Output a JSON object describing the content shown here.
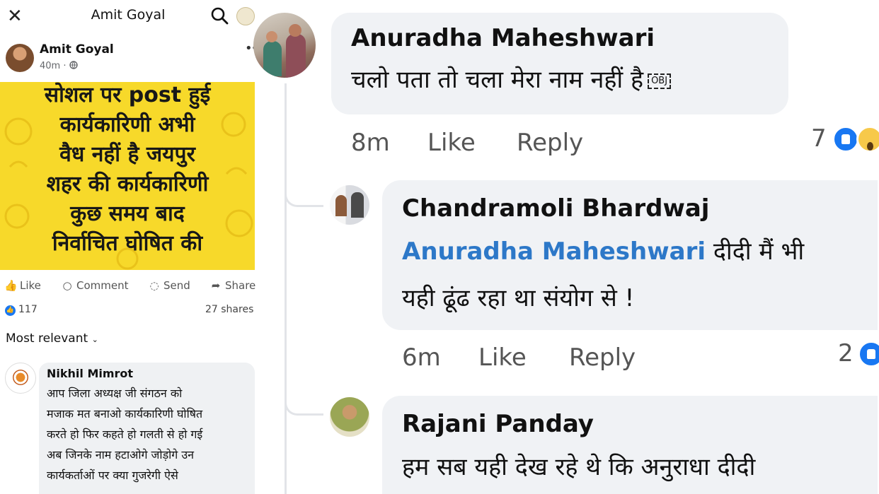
{
  "left_panel": {
    "topbar": {
      "close_glyph": "✕",
      "title": "Amit Goyal"
    },
    "post": {
      "author": "Amit Goyal",
      "time": "40m",
      "separator": "·",
      "image_text": [
        "सोशल पर post हुई",
        "कार्यकारिणी अभी",
        "वैध नहीं है जयपुर",
        "शहर की कार्यकारिणी",
        "कुछ समय बाद",
        "निर्वाचित घोषित की"
      ],
      "image_background": "#f7d92a",
      "actions": {
        "like": "Like",
        "comment": "Comment",
        "send": "Send",
        "share": "Share"
      },
      "likes_count": "117",
      "shares": "27 shares"
    },
    "sort_label": "Most relevant",
    "comment": {
      "author": "Nikhil Mimrot",
      "lines": [
        "आप जिला अध्यक्ष जी संगठन को",
        "मजाक मत बनाओ कार्यकारिणी घोषित",
        "करते हो फिर कहते हो गलती से हो गई",
        "अब जिनके नाम हटाओगे जोड़ोगे उन",
        "कार्यकर्ताओं पर क्या गुजरेगी ऐसे"
      ]
    }
  },
  "right_panel": {
    "comments": [
      {
        "author": "Anuradha Maheshwari",
        "text": "चलो पता तो चला मेरा नाम नहीं है",
        "obj_label": "OBJ",
        "time": "8m",
        "like": "Like",
        "reply": "Reply",
        "reactions": "7"
      },
      {
        "author": "Chandramoli Bhardwaj",
        "mention": "Anuradha Maheshwari",
        "text_after_mention": "दीदी मैं भी",
        "text_line2": "यही ढूंढ रहा था संयोग से  !",
        "time": "6m",
        "like": "Like",
        "reply": "Reply",
        "reactions": "2"
      },
      {
        "author": "Rajani Panday",
        "text": "हम सब यही देख रहे थे कि अनुराधा दीदी"
      }
    ]
  },
  "colors": {
    "link_blue": "#2d78c8",
    "like_blue": "#1877f2",
    "bubble_gray": "#f0f2f5"
  }
}
